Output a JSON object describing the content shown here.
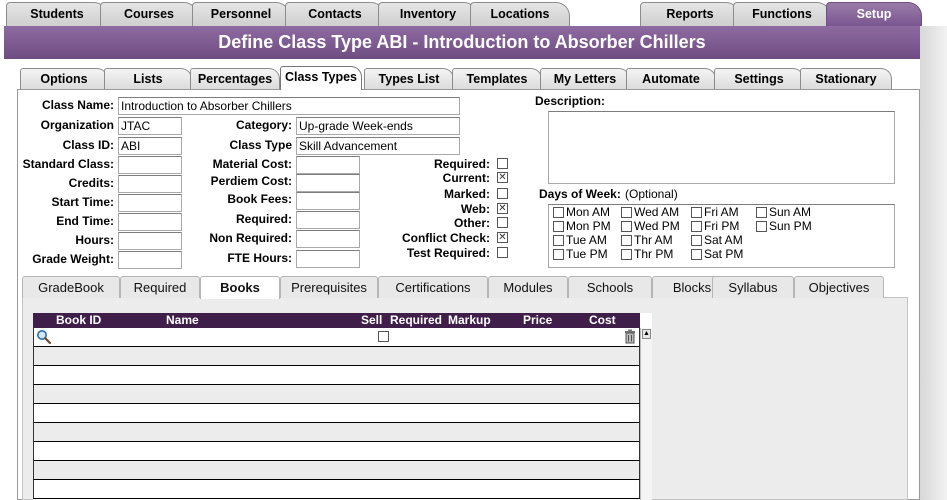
{
  "top_tabs": [
    "Students",
    "Courses",
    "Personnel",
    "Contacts",
    "Inventory",
    "Locations",
    "Reports",
    "Functions",
    "Setup"
  ],
  "title": "Define Class Type ABI - Introduction to Absorber Chillers",
  "sub_tabs": [
    "Options",
    "Lists",
    "Percentages",
    "Class Types",
    "Types List",
    "Templates",
    "My Letters",
    "Automate",
    "Settings",
    "Stationary"
  ],
  "form": {
    "class_name_label": "Class Name:",
    "class_name": "Introduction to Absorber Chillers",
    "organization_label": "Organization",
    "organization": "JTAC",
    "class_id_label": "Class ID:",
    "class_id": "ABI",
    "standard_class_label": "Standard Class:",
    "credits_label": "Credits:",
    "start_time_label": "Start Time:",
    "end_time_label": "End Time:",
    "hours_label": "Hours:",
    "grade_weight_label": "Grade Weight:",
    "category_label": "Category:",
    "category": "Up-grade Week-ends",
    "class_type_label": "Class Type",
    "class_type": "Skill Advancement",
    "material_cost_label": "Material Cost:",
    "perdiem_cost_label": "Perdiem Cost:",
    "book_fees_label": "Book Fees:",
    "required_label": "Required:",
    "non_required_label": "Non Required:",
    "fte_hours_label": "FTE Hours:",
    "flags": [
      {
        "label": "Required:",
        "checked": false
      },
      {
        "label": "Current:",
        "checked": true
      },
      {
        "label": "Marked:",
        "checked": false
      },
      {
        "label": "Web:",
        "checked": true
      },
      {
        "label": "Other:",
        "checked": false
      },
      {
        "label": "Conflict Check:",
        "checked": true
      },
      {
        "label": "Test Required:",
        "checked": false
      }
    ],
    "description_label": "Description:",
    "days_label": "Days of Week:",
    "days_optional": "(Optional)",
    "days": [
      "Mon AM",
      "Wed AM",
      "Fri AM",
      "Sun AM",
      "Mon PM",
      "Wed PM",
      "Fri PM",
      "Sun PM",
      "Tue AM",
      "Thr AM",
      "Sat AM",
      "Tue PM",
      "Thr PM",
      "Sat PM"
    ]
  },
  "lower_tabs": [
    "GradeBook",
    "Required",
    "Books",
    "Prerequisites",
    "Certifications",
    "Modules",
    "Schools",
    "Blocks",
    "Syllabus",
    "Objectives"
  ],
  "books_table": {
    "columns": [
      "Book ID",
      "Name",
      "Sell",
      "Required",
      "Markup",
      "Price",
      "Cost"
    ]
  }
}
